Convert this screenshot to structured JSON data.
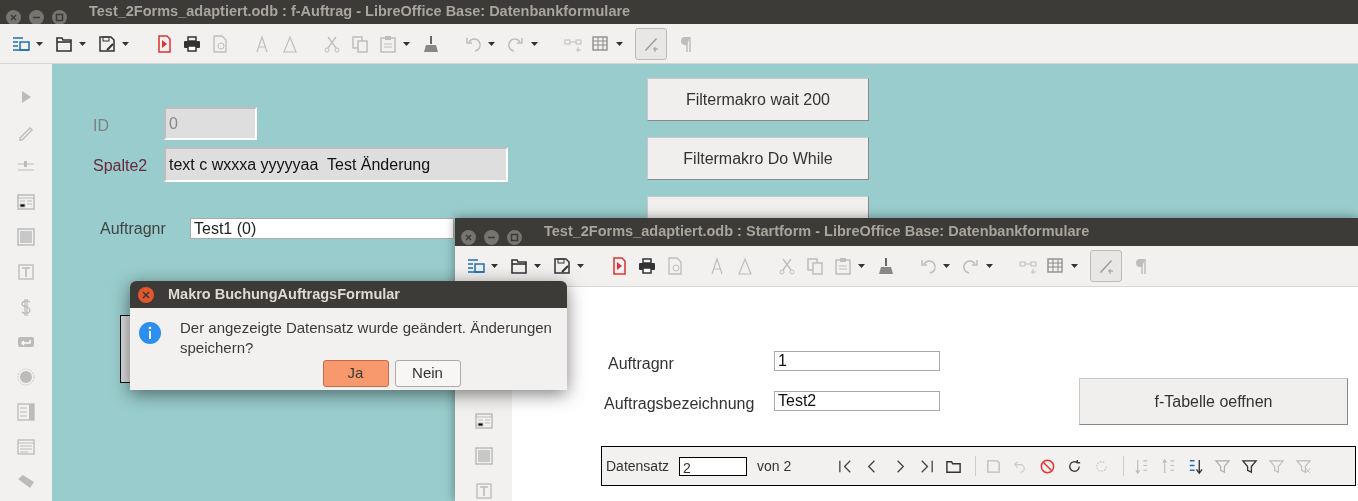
{
  "main_window": {
    "title": "Test_2Forms_adaptiert.odb : f-Auftrag - LibreOffice Base: Datenbankformulare",
    "fields": [
      {
        "label": "ID",
        "value": "0",
        "disabled": true
      },
      {
        "label": "Spalte2",
        "value": "text c wxxxa yyyyyaa  Test Änderung",
        "disabled": false
      }
    ],
    "order_field": {
      "label": "Auftragnr",
      "value": "Test1 (0)"
    },
    "buttons": [
      "Filtermakro wait 200",
      "Filtermakro Do While"
    ]
  },
  "start_window": {
    "title": "Test_2Forms_adaptiert.odb : Startform - LibreOffice Base: Datenbankformulare",
    "fields": [
      {
        "label": "Auftragnr",
        "value": "1"
      },
      {
        "label": "Auftragsbezeichnung",
        "value": "Test2"
      }
    ],
    "button": "f-Tabelle oeffnen",
    "navigation": {
      "label": "Datensatz",
      "record": "2",
      "total": "von 2"
    }
  },
  "dialog": {
    "title": "Makro BuchungAuftragsFormular",
    "message": "Der angezeigte Datensatz wurde geändert. Änderungen speichern?",
    "buttons": [
      {
        "label": "Ja",
        "selected": true
      },
      {
        "label": "Nein",
        "selected": false
      }
    ]
  }
}
